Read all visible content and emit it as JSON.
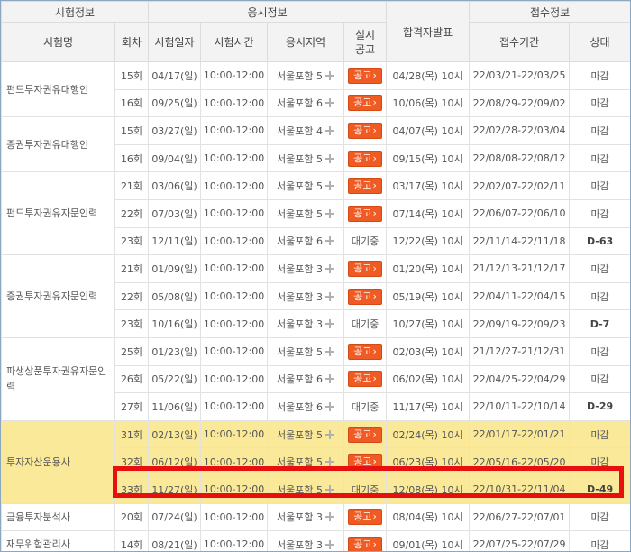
{
  "headers": {
    "group1": "시험정보",
    "group2": "응시정보",
    "group3": "접수정보",
    "exam_name": "시험명",
    "round": "회차",
    "exam_date": "시험일자",
    "exam_time": "시험시간",
    "region": "응시지역",
    "notice": "실시공고",
    "result": "합격자발표",
    "period": "접수기간",
    "status": "상태"
  },
  "exams": [
    {
      "name": "펀드투자권유대행인",
      "rows": [
        {
          "round": "15회",
          "date": "04/17(일)",
          "time": "10:00-12:00",
          "region": "서울포함 5",
          "notice": "공고",
          "result": "04/28(목) 10시",
          "period": "22/03/21-22/03/25",
          "status": "마감"
        },
        {
          "round": "16회",
          "date": "09/25(일)",
          "time": "10:00-12:00",
          "region": "서울포함 6",
          "notice": "공고",
          "result": "10/06(목) 10시",
          "period": "22/08/29-22/09/02",
          "status": "마감"
        }
      ]
    },
    {
      "name": "증권투자권유대행인",
      "rows": [
        {
          "round": "15회",
          "date": "03/27(일)",
          "time": "10:00-12:00",
          "region": "서울포함 4",
          "notice": "공고",
          "result": "04/07(목) 10시",
          "period": "22/02/28-22/03/04",
          "status": "마감"
        },
        {
          "round": "16회",
          "date": "09/04(일)",
          "time": "10:00-12:00",
          "region": "서울포함 5",
          "notice": "공고",
          "result": "09/15(목) 10시",
          "period": "22/08/08-22/08/12",
          "status": "마감"
        }
      ]
    },
    {
      "name": "펀드투자권유자문인력",
      "rows": [
        {
          "round": "21회",
          "date": "03/06(일)",
          "time": "10:00-12:00",
          "region": "서울포함 5",
          "notice": "공고",
          "result": "03/17(목) 10시",
          "period": "22/02/07-22/02/11",
          "status": "마감"
        },
        {
          "round": "22회",
          "date": "07/03(일)",
          "time": "10:00-12:00",
          "region": "서울포함 5",
          "notice": "공고",
          "result": "07/14(목) 10시",
          "period": "22/06/07-22/06/10",
          "status": "마감"
        },
        {
          "round": "23회",
          "date": "12/11(일)",
          "time": "10:00-12:00",
          "region": "서울포함 6",
          "notice": "대기중",
          "result": "12/22(목) 10시",
          "period": "22/11/14-22/11/18",
          "status": "D-63"
        }
      ]
    },
    {
      "name": "증권투자권유자문인력",
      "rows": [
        {
          "round": "21회",
          "date": "01/09(일)",
          "time": "10:00-12:00",
          "region": "서울포함 3",
          "notice": "공고",
          "result": "01/20(목) 10시",
          "period": "21/12/13-21/12/17",
          "status": "마감"
        },
        {
          "round": "22회",
          "date": "05/08(일)",
          "time": "10:00-12:00",
          "region": "서울포함 3",
          "notice": "공고",
          "result": "05/19(목) 10시",
          "period": "22/04/11-22/04/15",
          "status": "마감"
        },
        {
          "round": "23회",
          "date": "10/16(일)",
          "time": "10:00-12:00",
          "region": "서울포함 3",
          "notice": "대기중",
          "result": "10/27(목) 10시",
          "period": "22/09/19-22/09/23",
          "status": "D-7"
        }
      ]
    },
    {
      "name": "파생상품투자권유자문인력",
      "rows": [
        {
          "round": "25회",
          "date": "01/23(일)",
          "time": "10:00-12:00",
          "region": "서울포함 5",
          "notice": "공고",
          "result": "02/03(목) 10시",
          "period": "21/12/27-21/12/31",
          "status": "마감"
        },
        {
          "round": "26회",
          "date": "05/22(일)",
          "time": "10:00-12:00",
          "region": "서울포함 6",
          "notice": "공고",
          "result": "06/02(목) 10시",
          "period": "22/04/25-22/04/29",
          "status": "마감"
        },
        {
          "round": "27회",
          "date": "11/06(일)",
          "time": "10:00-12:00",
          "region": "서울포함 6",
          "notice": "대기중",
          "result": "11/17(목) 10시",
          "period": "22/10/11-22/10/14",
          "status": "D-29"
        }
      ]
    },
    {
      "name": "투자자산운용사",
      "highlight": true,
      "rows": [
        {
          "round": "31회",
          "date": "02/13(일)",
          "time": "10:00-12:00",
          "region": "서울포함 5",
          "notice": "공고",
          "result": "02/24(목) 10시",
          "period": "22/01/17-22/01/21",
          "status": "마감"
        },
        {
          "round": "32회",
          "date": "06/12(일)",
          "time": "10:00-12:00",
          "region": "서울포함 5",
          "notice": "공고",
          "result": "06/23(목) 10시",
          "period": "22/05/16-22/05/20",
          "status": "마감"
        },
        {
          "round": "33회",
          "date": "11/27(일)",
          "time": "10:00-12:00",
          "region": "서울포함 5",
          "notice": "대기중",
          "result": "12/08(목) 10시",
          "period": "22/10/31-22/11/04",
          "status": "D-49"
        }
      ]
    },
    {
      "name": "금융투자분석사",
      "rows": [
        {
          "round": "20회",
          "date": "07/24(일)",
          "time": "10:00-12:00",
          "region": "서울포함 3",
          "notice": "공고",
          "result": "08/04(목) 10시",
          "period": "22/06/27-22/07/01",
          "status": "마감"
        }
      ]
    },
    {
      "name": "재무위험관리사",
      "rows": [
        {
          "round": "14회",
          "date": "08/21(일)",
          "time": "10:00-12:00",
          "region": "서울포함 3",
          "notice": "공고",
          "result": "09/01(목) 10시",
          "period": "22/07/25-22/07/29",
          "status": "마감"
        }
      ]
    }
  ],
  "colors": {
    "accent": "#f05a23",
    "highlight": "#fbe99a",
    "marker": "#e8100f"
  },
  "icons": {
    "region_add": "plus-icon",
    "notice_arrow": "chevron-right-icon"
  }
}
